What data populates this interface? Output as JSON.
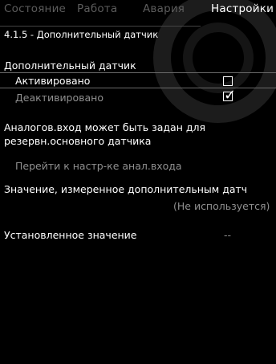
{
  "tabs": [
    {
      "label": "Состояние",
      "active": false
    },
    {
      "label": "Работа",
      "active": false
    },
    {
      "label": "Авария",
      "active": false
    },
    {
      "label": "Настройки",
      "active": true
    }
  ],
  "breadcrumb": "4.1.5 - Дополнительный датчик",
  "sensor_section": {
    "title": "Дополнительный датчик",
    "options": [
      {
        "label": "Активировано",
        "checked": false
      },
      {
        "label": "Деактивировано",
        "checked": true
      }
    ]
  },
  "analog_info": {
    "line1": "Аналогов.вход может быть задан для",
    "line2": "резервн.основного датчика",
    "link_label": "Перейти к настр-ке анал.входа"
  },
  "measured": {
    "label": "Значение, измеренное дополнительным датч",
    "value": "(Не используется)"
  },
  "setpoint": {
    "label": "Установленное значение",
    "value": "--"
  },
  "colors": {
    "background": "#000000",
    "text": "#ffffff",
    "inactive_tab": "#5c5c5c",
    "dim_text": "#8f8f8f"
  },
  "icons": {
    "watermark": "grundfos-ring-icon",
    "checkmark": "check-icon"
  }
}
